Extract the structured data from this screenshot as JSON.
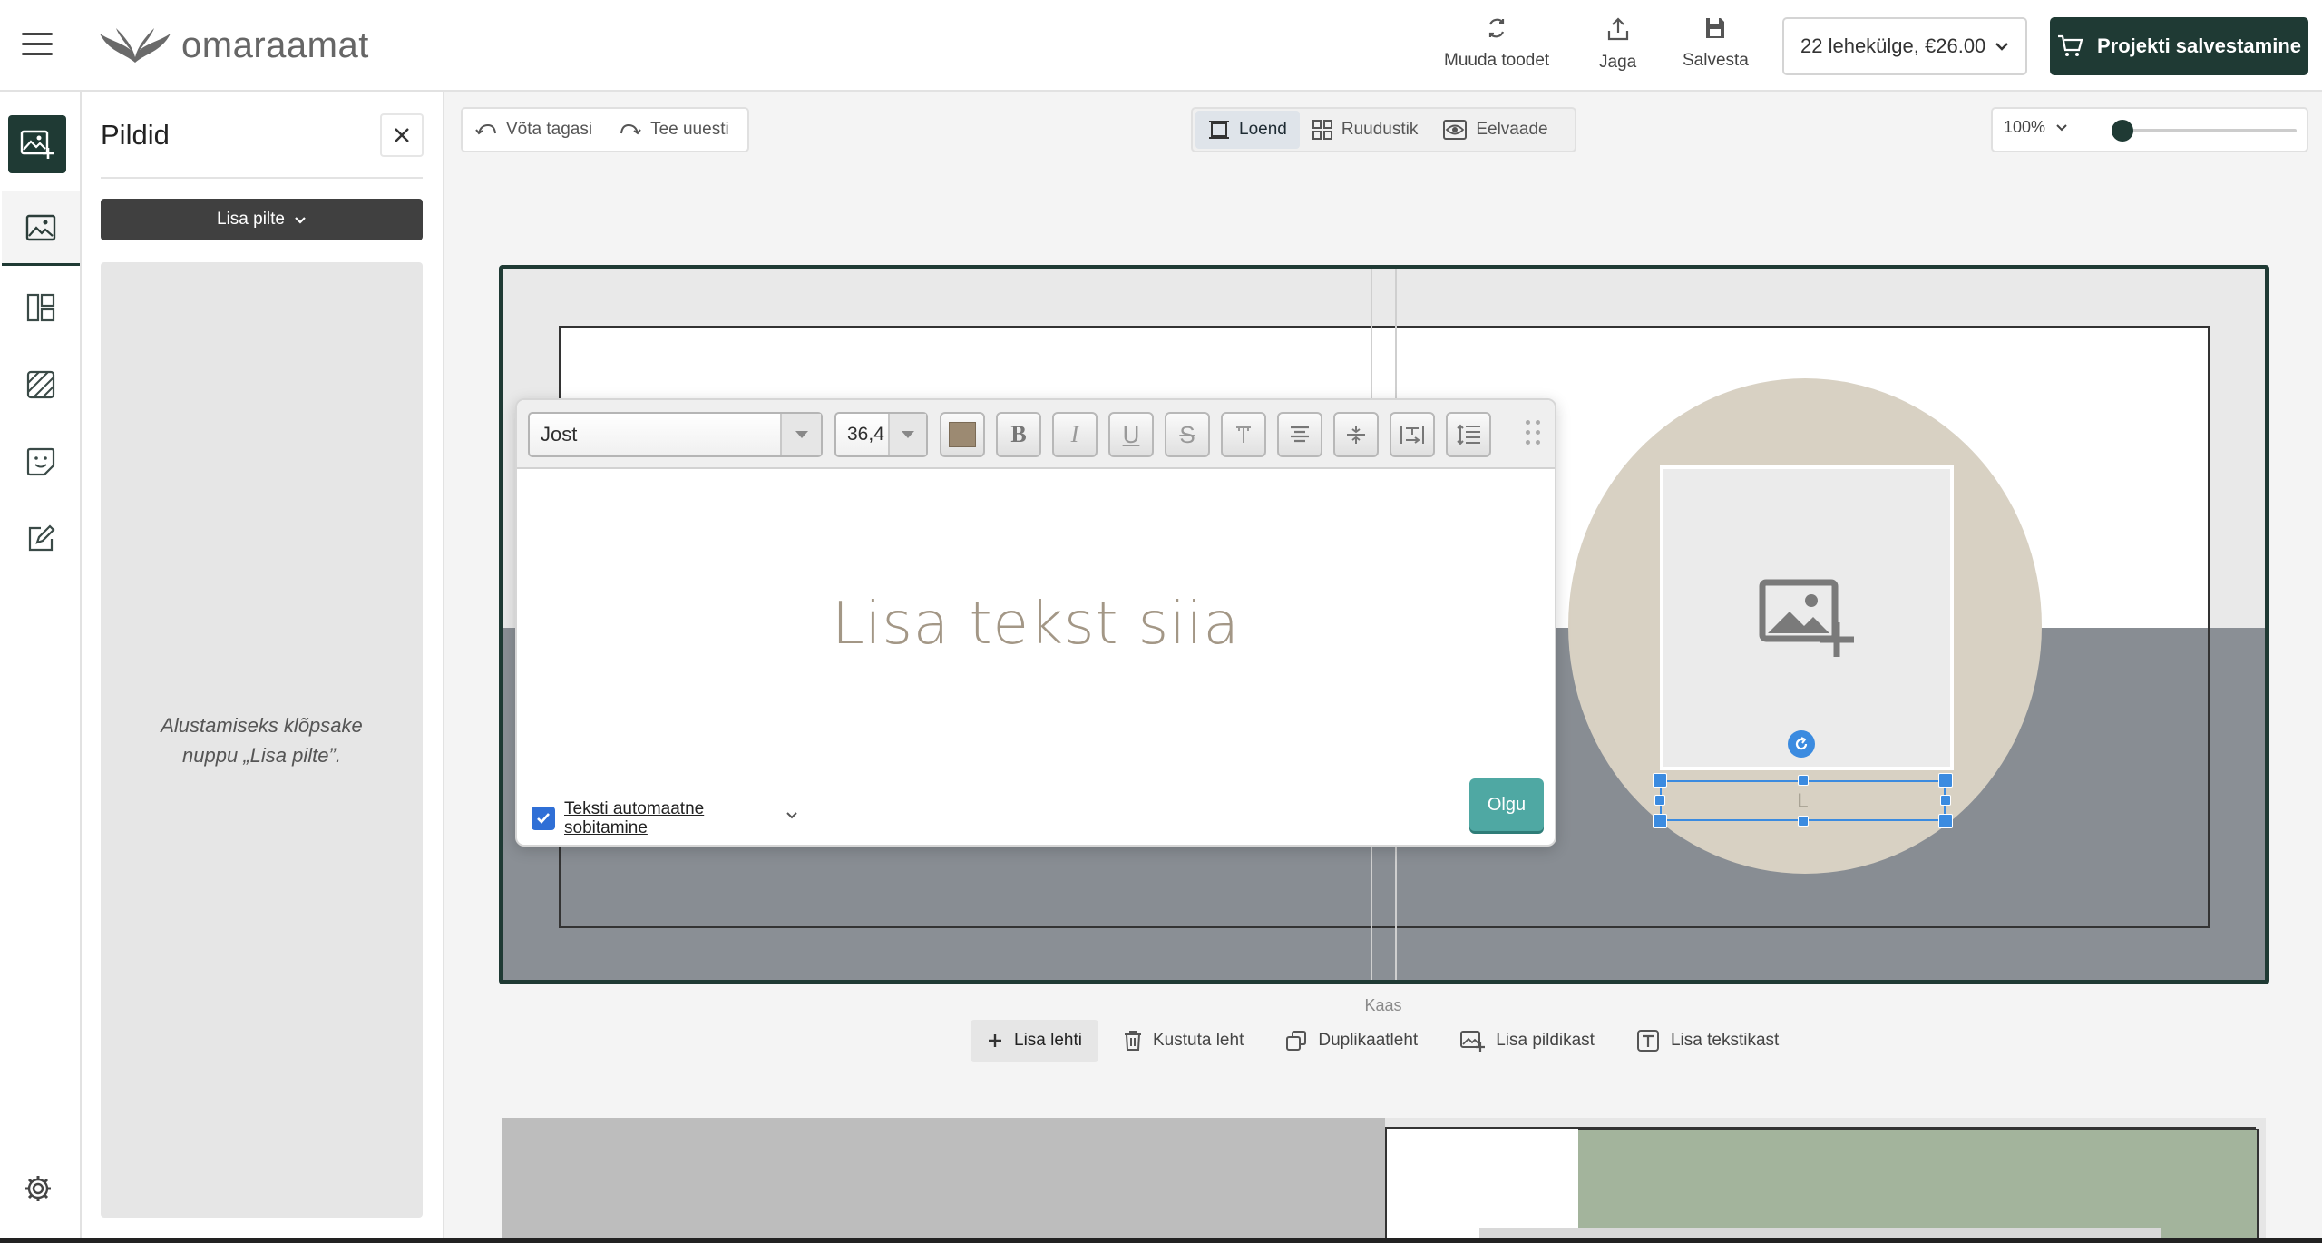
{
  "brand": {
    "name": "omaraamat"
  },
  "topbar": {
    "change_product": "Muuda toodet",
    "share": "Jaga",
    "save": "Salvesta",
    "pages_price": "22 lehekülge, €26.00",
    "save_project": "Projekti salvestamine"
  },
  "panel": {
    "title": "Pildid",
    "add_pictures": "Lisa pilte",
    "empty_hint": "Alustamiseks klõpsake nuppu „Lisa pilte”."
  },
  "history": {
    "undo": "Võta tagasi",
    "redo": "Tee uuesti"
  },
  "views": {
    "list": "Loend",
    "grid": "Ruudustik",
    "preview": "Eelvaade",
    "active": "Loend"
  },
  "zoom": {
    "value": "100%",
    "level": 0.0
  },
  "editor": {
    "font": "Jost",
    "size": "36,4",
    "color": "#9c8a72",
    "placeholder": "Lisa tekst siia",
    "autofit_label": "Teksti automaatne sobitamine",
    "autofit_checked": true,
    "ok": "Olgu"
  },
  "selection": {
    "text_placeholder": "L"
  },
  "page": {
    "label": "Kaas",
    "actions": {
      "add_page": "Lisa lehti",
      "delete_page": "Kustuta leht",
      "duplicate_page": "Duplikaatleht",
      "add_image_box": "Lisa pildikast",
      "add_text_box": "Lisa tekstikast"
    }
  },
  "colors": {
    "brand_dark": "#1f3a34",
    "ok_teal": "#4fa8a3",
    "selection_blue": "#3b8be0",
    "circle_beige": "#d8d1c3",
    "band_gray": "#888d93"
  }
}
